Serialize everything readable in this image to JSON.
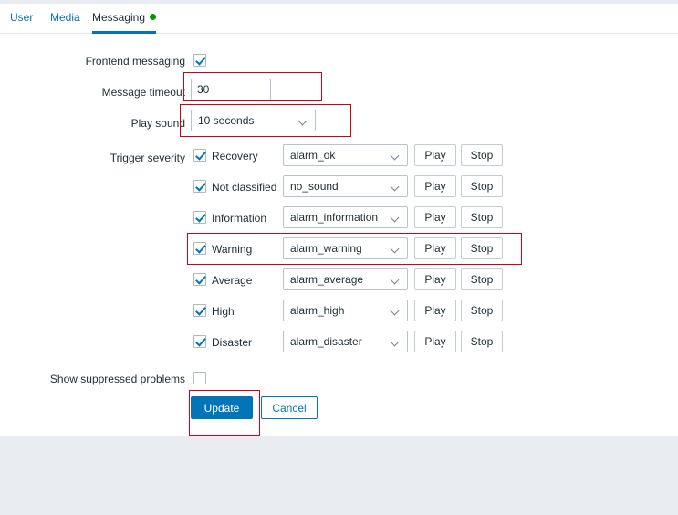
{
  "tabs": [
    {
      "label": "User",
      "active": false,
      "dot": false
    },
    {
      "label": "Media",
      "active": false,
      "dot": false
    },
    {
      "label": "Messaging",
      "active": true,
      "dot": true
    }
  ],
  "form": {
    "frontend_messaging": {
      "label": "Frontend messaging",
      "checked": true
    },
    "message_timeout": {
      "label": "Message timeout",
      "value": "30"
    },
    "play_sound": {
      "label": "Play sound",
      "value": "10 seconds"
    },
    "trigger_severity": {
      "label": "Trigger severity"
    },
    "show_suppressed": {
      "label": "Show suppressed problems",
      "checked": false
    }
  },
  "severities": [
    {
      "name": "Recovery",
      "checked": true,
      "sound": "alarm_ok",
      "play": "Play",
      "stop": "Stop"
    },
    {
      "name": "Not classified",
      "checked": true,
      "sound": "no_sound",
      "play": "Play",
      "stop": "Stop"
    },
    {
      "name": "Information",
      "checked": true,
      "sound": "alarm_information",
      "play": "Play",
      "stop": "Stop"
    },
    {
      "name": "Warning",
      "checked": true,
      "sound": "alarm_warning",
      "play": "Play",
      "stop": "Stop"
    },
    {
      "name": "Average",
      "checked": true,
      "sound": "alarm_average",
      "play": "Play",
      "stop": "Stop"
    },
    {
      "name": "High",
      "checked": true,
      "sound": "alarm_high",
      "play": "Play",
      "stop": "Stop"
    },
    {
      "name": "Disaster",
      "checked": true,
      "sound": "alarm_disaster",
      "play": "Play",
      "stop": "Stop"
    }
  ],
  "actions": {
    "update": "Update",
    "cancel": "Cancel"
  },
  "colors": {
    "accent": "#0275b8",
    "annotation": "#d0021b",
    "status_dot": "#009900",
    "page_bg": "#e9edf1"
  }
}
